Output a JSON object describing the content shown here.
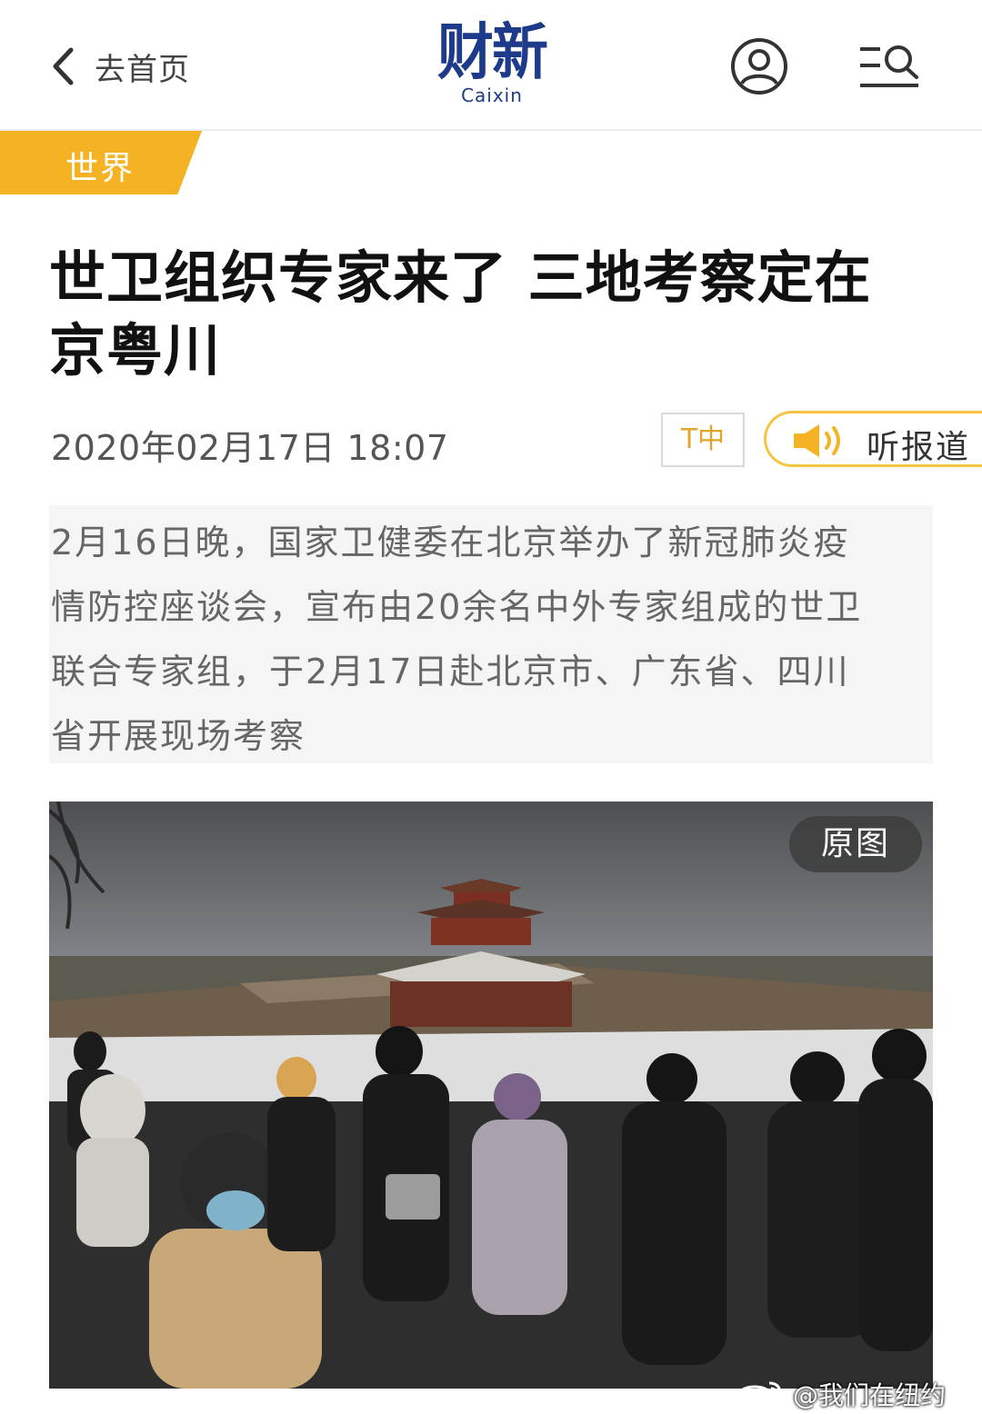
{
  "header": {
    "back_label": "去首页",
    "logo_cn": "财新",
    "logo_en": "Caixin",
    "brand_color": "#1e3a8a"
  },
  "section": {
    "tag": "世界",
    "color": "#f5b324"
  },
  "article": {
    "title_lines": [
      "世卫组织专家来了 三地考察定在",
      "京粤川"
    ],
    "date": "2020年02月17日 18:07",
    "font_size_label": "T中",
    "listen_label": "听报道",
    "summary_lines": [
      "2月16日晚，国家卫健委在北京举办了新冠肺炎疫",
      "情防控座谈会，宣布由20余名中外专家组成的世卫",
      "联合专家组，于2月17日赴北京市、广东省、四川",
      "省开展现场考察"
    ]
  },
  "photo": {
    "original_button": "原图"
  },
  "watermark": {
    "text": "@我们在纽约"
  },
  "icons": {
    "back": "chevron-left-icon",
    "user": "user-circle-icon",
    "menu": "menu-search-icon",
    "speaker": "speaker-icon",
    "weibo": "weibo-logo"
  }
}
